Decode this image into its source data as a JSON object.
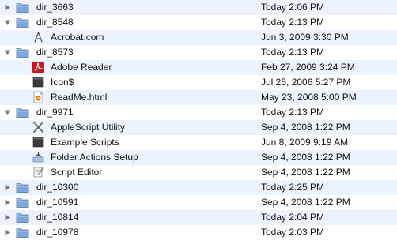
{
  "rows": [
    {
      "name": "dir_3663",
      "date": "Today 2:06 PM",
      "depth": 0,
      "icon": "folder-icon",
      "expanded": false
    },
    {
      "name": "dir_8548",
      "date": "Today 2:13 PM",
      "depth": 0,
      "icon": "folder-icon",
      "expanded": true
    },
    {
      "name": "Acrobat.com",
      "date": "Jun 3, 2009 3:30 PM",
      "depth": 1,
      "icon": "application-icon"
    },
    {
      "name": "dir_8573",
      "date": "Today 2:13 PM",
      "depth": 0,
      "icon": "folder-icon",
      "expanded": true
    },
    {
      "name": "Adobe Reader",
      "date": "Feb 27, 2009 3:24 PM",
      "depth": 1,
      "icon": "pdf-app-icon"
    },
    {
      "name": "Icon$",
      "date": "Jul 25, 2006 5:27 PM",
      "depth": 1,
      "icon": "blank-document-icon"
    },
    {
      "name": "ReadMe.html",
      "date": "May 23, 2008 5:00 PM",
      "depth": 1,
      "icon": "html-document-icon"
    },
    {
      "name": "dir_9971",
      "date": "Today 2:13 PM",
      "depth": 0,
      "icon": "folder-icon",
      "expanded": true
    },
    {
      "name": "AppleScript Utility",
      "date": "Sep 4, 2008 1:22 PM",
      "depth": 1,
      "icon": "tools-icon"
    },
    {
      "name": "Example Scripts",
      "date": "Jun 8, 2009 9:19 AM",
      "depth": 1,
      "icon": "alias-icon"
    },
    {
      "name": "Folder Actions Setup",
      "date": "Sep 4, 2008 1:22 PM",
      "depth": 1,
      "icon": "folder-actions-icon"
    },
    {
      "name": "Script Editor",
      "date": "Sep 4, 2008 1:22 PM",
      "depth": 1,
      "icon": "script-editor-icon"
    },
    {
      "name": "dir_10300",
      "date": "Today 2:25 PM",
      "depth": 0,
      "icon": "folder-icon",
      "expanded": false
    },
    {
      "name": "dir_10591",
      "date": "Sep 4, 2008 1:22 PM",
      "depth": 0,
      "icon": "folder-icon",
      "expanded": false
    },
    {
      "name": "dir_10814",
      "date": "Today 2:04 PM",
      "depth": 0,
      "icon": "folder-icon",
      "expanded": false
    },
    {
      "name": "dir_10978",
      "date": "Today 2:03 PM",
      "depth": 0,
      "icon": "folder-icon",
      "expanded": false
    }
  ],
  "colors": {
    "alternate_row": "#edf3fe",
    "folder": "#7fa6d6",
    "disclosure_triangle": "#7a7a7a"
  }
}
